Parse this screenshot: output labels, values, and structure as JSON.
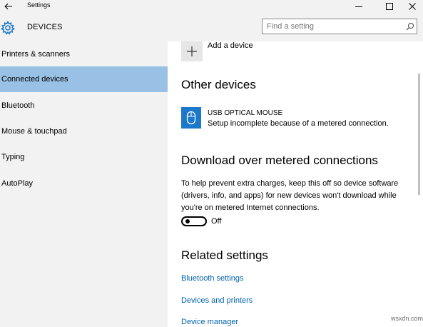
{
  "window": {
    "title": "Settings",
    "back_icon": "arrow-left-icon",
    "minimize_icon": "minimize-icon",
    "maximize_icon": "maximize-icon",
    "close_icon": "close-icon"
  },
  "header": {
    "icon": "gear-icon",
    "title": "DEVICES",
    "search_placeholder": "Find a setting",
    "search_value": "",
    "search_icon": "search-icon"
  },
  "sidebar": {
    "selected_color": "#99c1e6",
    "items": [
      {
        "label": "Printers & scanners",
        "selected": false
      },
      {
        "label": "Connected devices",
        "selected": true
      },
      {
        "label": "Bluetooth",
        "selected": false
      },
      {
        "label": "Mouse & touchpad",
        "selected": false
      },
      {
        "label": "Typing",
        "selected": false
      },
      {
        "label": "AutoPlay",
        "selected": false
      }
    ]
  },
  "main": {
    "add_device_label": "Add a device",
    "add_icon": "plus-icon",
    "other_devices_heading": "Other devices",
    "device": {
      "icon": "mouse-icon",
      "name": "USB OPTICAL MOUSE",
      "status": "Setup incomplete because of a metered connection."
    },
    "metered_heading": "Download over metered connections",
    "metered_desc_lines": [
      "To help prevent extra charges, keep this off so device software",
      "(drivers, info, and apps) for new devices won't download while",
      "you're on metered Internet connections."
    ],
    "toggle": {
      "state": "off",
      "label": "Off"
    },
    "related_heading": "Related settings",
    "related_links": [
      "Bluetooth settings",
      "Devices and printers",
      "Device manager"
    ],
    "link_color": "#0063b1",
    "accent_color": "#1c78c9"
  },
  "watermark": "wsxdn.com"
}
